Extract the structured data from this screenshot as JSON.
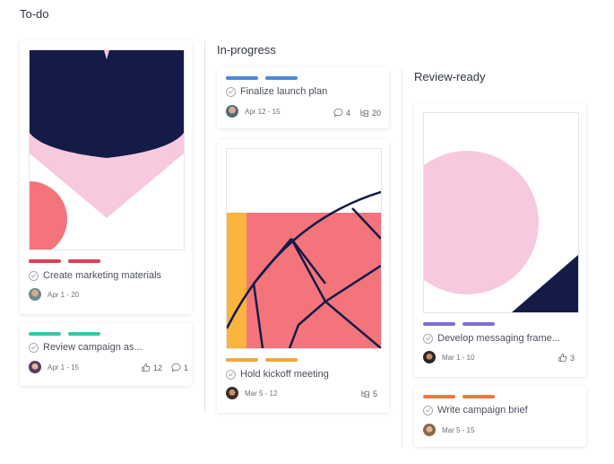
{
  "columns": [
    {
      "title": "To-do"
    },
    {
      "title": "In-progress"
    },
    {
      "title": "Review-ready"
    }
  ],
  "cards": {
    "marketing": {
      "title": "Create marketing materials",
      "date": "Apr 1 - 20",
      "tag_color": "#d93f56"
    },
    "review_campaign": {
      "title": "Review campaign as...",
      "date": "Apr 1 - 15",
      "likes": "12",
      "comments": "1",
      "tag_color": "#37c5a3"
    },
    "launch_plan": {
      "title": "Finalize launch plan",
      "date": "Apr 12 - 15",
      "comments": "4",
      "subtasks": "20",
      "tag_color": "#4a8ad8"
    },
    "kickoff": {
      "title": "Hold kickoff meeting",
      "date": "Mar 5 - 12",
      "subtasks": "5",
      "tag_color": "#f2a93b"
    },
    "messaging": {
      "title": "Develop messaging frame...",
      "date": "Mar 1 - 10",
      "likes": "3",
      "tag_color": "#7d6fd6"
    },
    "brief": {
      "title": "Write campaign brief",
      "date": "Mar 5 - 15",
      "tag_color": "#f0743d"
    }
  },
  "icons": [
    "check-circle-icon",
    "thumbs-up-icon",
    "comment-icon",
    "subtask-icon"
  ]
}
